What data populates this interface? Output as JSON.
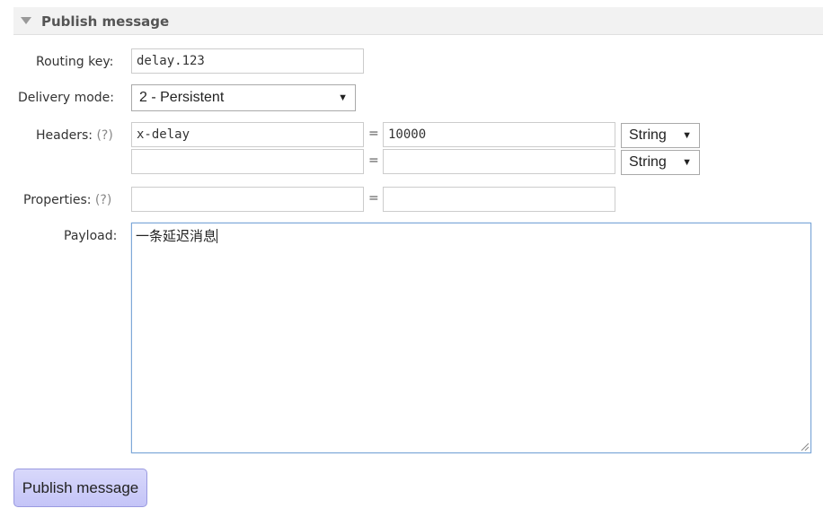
{
  "section": {
    "title": "Publish message",
    "caret_icon": "triangle-down-icon"
  },
  "routing": {
    "label": "Routing key:",
    "value": "delay.123"
  },
  "delivery": {
    "label": "Delivery mode:",
    "selected": "2 - Persistent",
    "arrow": "▼"
  },
  "headers": {
    "label": "Headers:",
    "help": "(?)",
    "rows": [
      {
        "key": "x-delay",
        "eq": "=",
        "value": "10000",
        "type": "String"
      },
      {
        "key": "",
        "eq": "=",
        "value": "",
        "type": "String"
      }
    ]
  },
  "properties": {
    "label": "Properties:",
    "help": "(?)",
    "key": "",
    "eq": "=",
    "value": ""
  },
  "payload": {
    "label": "Payload:",
    "value": "一条延迟消息"
  },
  "publish": {
    "label": "Publish message"
  },
  "colors": {
    "button_bg": "#c8c8f8",
    "payload_focus_border": "#7ea8d8"
  }
}
